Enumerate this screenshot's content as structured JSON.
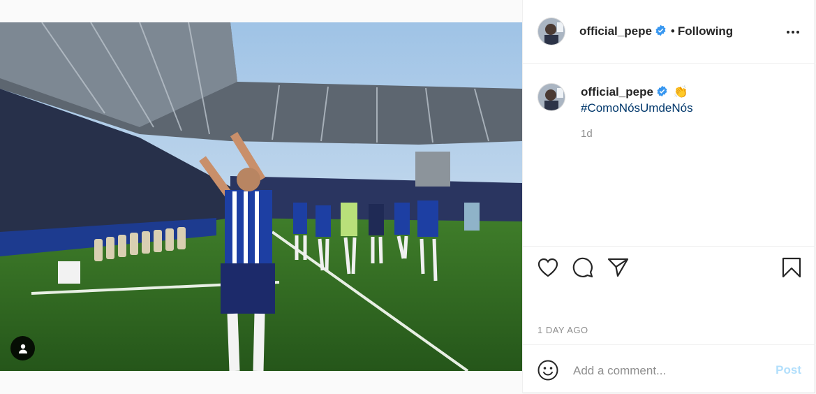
{
  "post": {
    "author": {
      "username": "official_pepe",
      "verified": true,
      "separator": "•",
      "follow_state": "Following"
    },
    "caption": {
      "username": "official_pepe",
      "emoji": "👏",
      "hashtag": "#ComoNósUmdeNós",
      "relative_time": "1d"
    },
    "date_label": "1 DAY AGO",
    "comment": {
      "placeholder": "Add a comment...",
      "post_label": "Post"
    },
    "icons": {
      "more": "more-options-icon",
      "like": "heart-icon",
      "comment": "comment-icon",
      "share": "paper-plane-icon",
      "save": "bookmark-icon",
      "emoji": "smiley-icon",
      "user_tags": "user-icon",
      "verified": "verified-badge-icon"
    },
    "colors": {
      "verified": "#3897f0",
      "link": "#00376b",
      "post_disabled": "#b2dffc",
      "muted": "#8e8e8e"
    }
  }
}
